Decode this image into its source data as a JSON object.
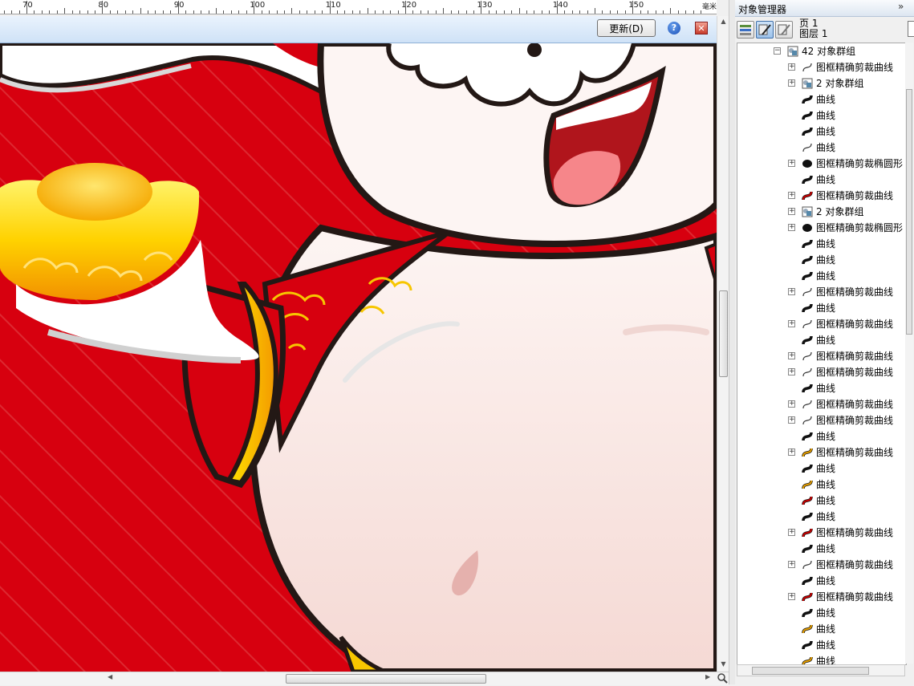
{
  "ruler": {
    "labels": [
      "70",
      "80",
      "90",
      "100",
      "110",
      "120",
      "130",
      "140",
      "150"
    ],
    "unit": "毫米"
  },
  "update_bar": {
    "update_label": "更新(D)",
    "help_glyph": "?",
    "close_glyph": "✕"
  },
  "docker": {
    "title": "对象管理器",
    "collapse_glyph": "»",
    "page_label": "页 1",
    "layer_label": "图层 1",
    "tree": [
      {
        "label": "42 对象群组",
        "icon": "group-icon",
        "expander": "−",
        "level": 0
      },
      {
        "label": "图框精确剪裁曲线",
        "icon": "curve-outline-icon",
        "expander": "+",
        "level": 1
      },
      {
        "label": "2 对象群组",
        "icon": "group-icon",
        "expander": "+",
        "level": 1
      },
      {
        "label": "曲线",
        "icon": "curve-black-icon",
        "expander": "",
        "level": 1
      },
      {
        "label": "曲线",
        "icon": "curve-black-icon",
        "expander": "",
        "level": 1
      },
      {
        "label": "曲线",
        "icon": "curve-black-icon",
        "expander": "",
        "level": 1
      },
      {
        "label": "曲线",
        "icon": "curve-outline-icon",
        "expander": "",
        "level": 1
      },
      {
        "label": "图框精确剪裁椭圆形",
        "icon": "ellipse-icon",
        "expander": "+",
        "level": 1
      },
      {
        "label": "曲线",
        "icon": "curve-black-icon",
        "expander": "",
        "level": 1
      },
      {
        "label": "图框精确剪裁曲线",
        "icon": "curve-red-icon",
        "expander": "+",
        "level": 1
      },
      {
        "label": "2 对象群组",
        "icon": "group-icon",
        "expander": "+",
        "level": 1
      },
      {
        "label": "图框精确剪裁椭圆形",
        "icon": "ellipse-icon",
        "expander": "+",
        "level": 1
      },
      {
        "label": "曲线",
        "icon": "curve-black-icon",
        "expander": "",
        "level": 1
      },
      {
        "label": "曲线",
        "icon": "curve-black-icon",
        "expander": "",
        "level": 1
      },
      {
        "label": "曲线",
        "icon": "curve-black-icon",
        "expander": "",
        "level": 1
      },
      {
        "label": "图框精确剪裁曲线",
        "icon": "curve-outline-icon",
        "expander": "+",
        "level": 1
      },
      {
        "label": "曲线",
        "icon": "curve-black-icon",
        "expander": "",
        "level": 1
      },
      {
        "label": "图框精确剪裁曲线",
        "icon": "curve-outline-icon",
        "expander": "+",
        "level": 1
      },
      {
        "label": "曲线",
        "icon": "curve-black-icon",
        "expander": "",
        "level": 1
      },
      {
        "label": "图框精确剪裁曲线",
        "icon": "curve-outline-icon",
        "expander": "+",
        "level": 1
      },
      {
        "label": "图框精确剪裁曲线",
        "icon": "curve-outline-icon",
        "expander": "+",
        "level": 1
      },
      {
        "label": "曲线",
        "icon": "curve-black-icon",
        "expander": "",
        "level": 1
      },
      {
        "label": "图框精确剪裁曲线",
        "icon": "curve-outline-icon",
        "expander": "+",
        "level": 1
      },
      {
        "label": "图框精确剪裁曲线",
        "icon": "curve-outline-icon",
        "expander": "+",
        "level": 1
      },
      {
        "label": "曲线",
        "icon": "curve-black-icon",
        "expander": "",
        "level": 1
      },
      {
        "label": "图框精确剪裁曲线",
        "icon": "curve-orange-icon",
        "expander": "+",
        "level": 1
      },
      {
        "label": "曲线",
        "icon": "curve-black-icon",
        "expander": "",
        "level": 1
      },
      {
        "label": "曲线",
        "icon": "curve-orange-icon",
        "expander": "",
        "level": 1
      },
      {
        "label": "曲线",
        "icon": "curve-red-icon",
        "expander": "",
        "level": 1
      },
      {
        "label": "曲线",
        "icon": "curve-black-icon",
        "expander": "",
        "level": 1
      },
      {
        "label": "图框精确剪裁曲线",
        "icon": "curve-red-icon",
        "expander": "+",
        "level": 1
      },
      {
        "label": "曲线",
        "icon": "curve-black-icon",
        "expander": "",
        "level": 1
      },
      {
        "label": "图框精确剪裁曲线",
        "icon": "curve-outline-icon",
        "expander": "+",
        "level": 1
      },
      {
        "label": "曲线",
        "icon": "curve-black-icon",
        "expander": "",
        "level": 1
      },
      {
        "label": "图框精确剪裁曲线",
        "icon": "curve-red-icon",
        "expander": "+",
        "level": 1
      },
      {
        "label": "曲线",
        "icon": "curve-black-icon",
        "expander": "",
        "level": 1
      },
      {
        "label": "曲线",
        "icon": "curve-orange-icon",
        "expander": "",
        "level": 1
      },
      {
        "label": "曲线",
        "icon": "curve-black-icon",
        "expander": "",
        "level": 1
      },
      {
        "label": "曲线",
        "icon": "curve-orange-icon",
        "expander": "",
        "level": 1
      }
    ]
  },
  "colors": {
    "background_red": "#d7000f",
    "outline": "#231815",
    "gold": "#f7c600",
    "skin": "#fdf3f1"
  }
}
